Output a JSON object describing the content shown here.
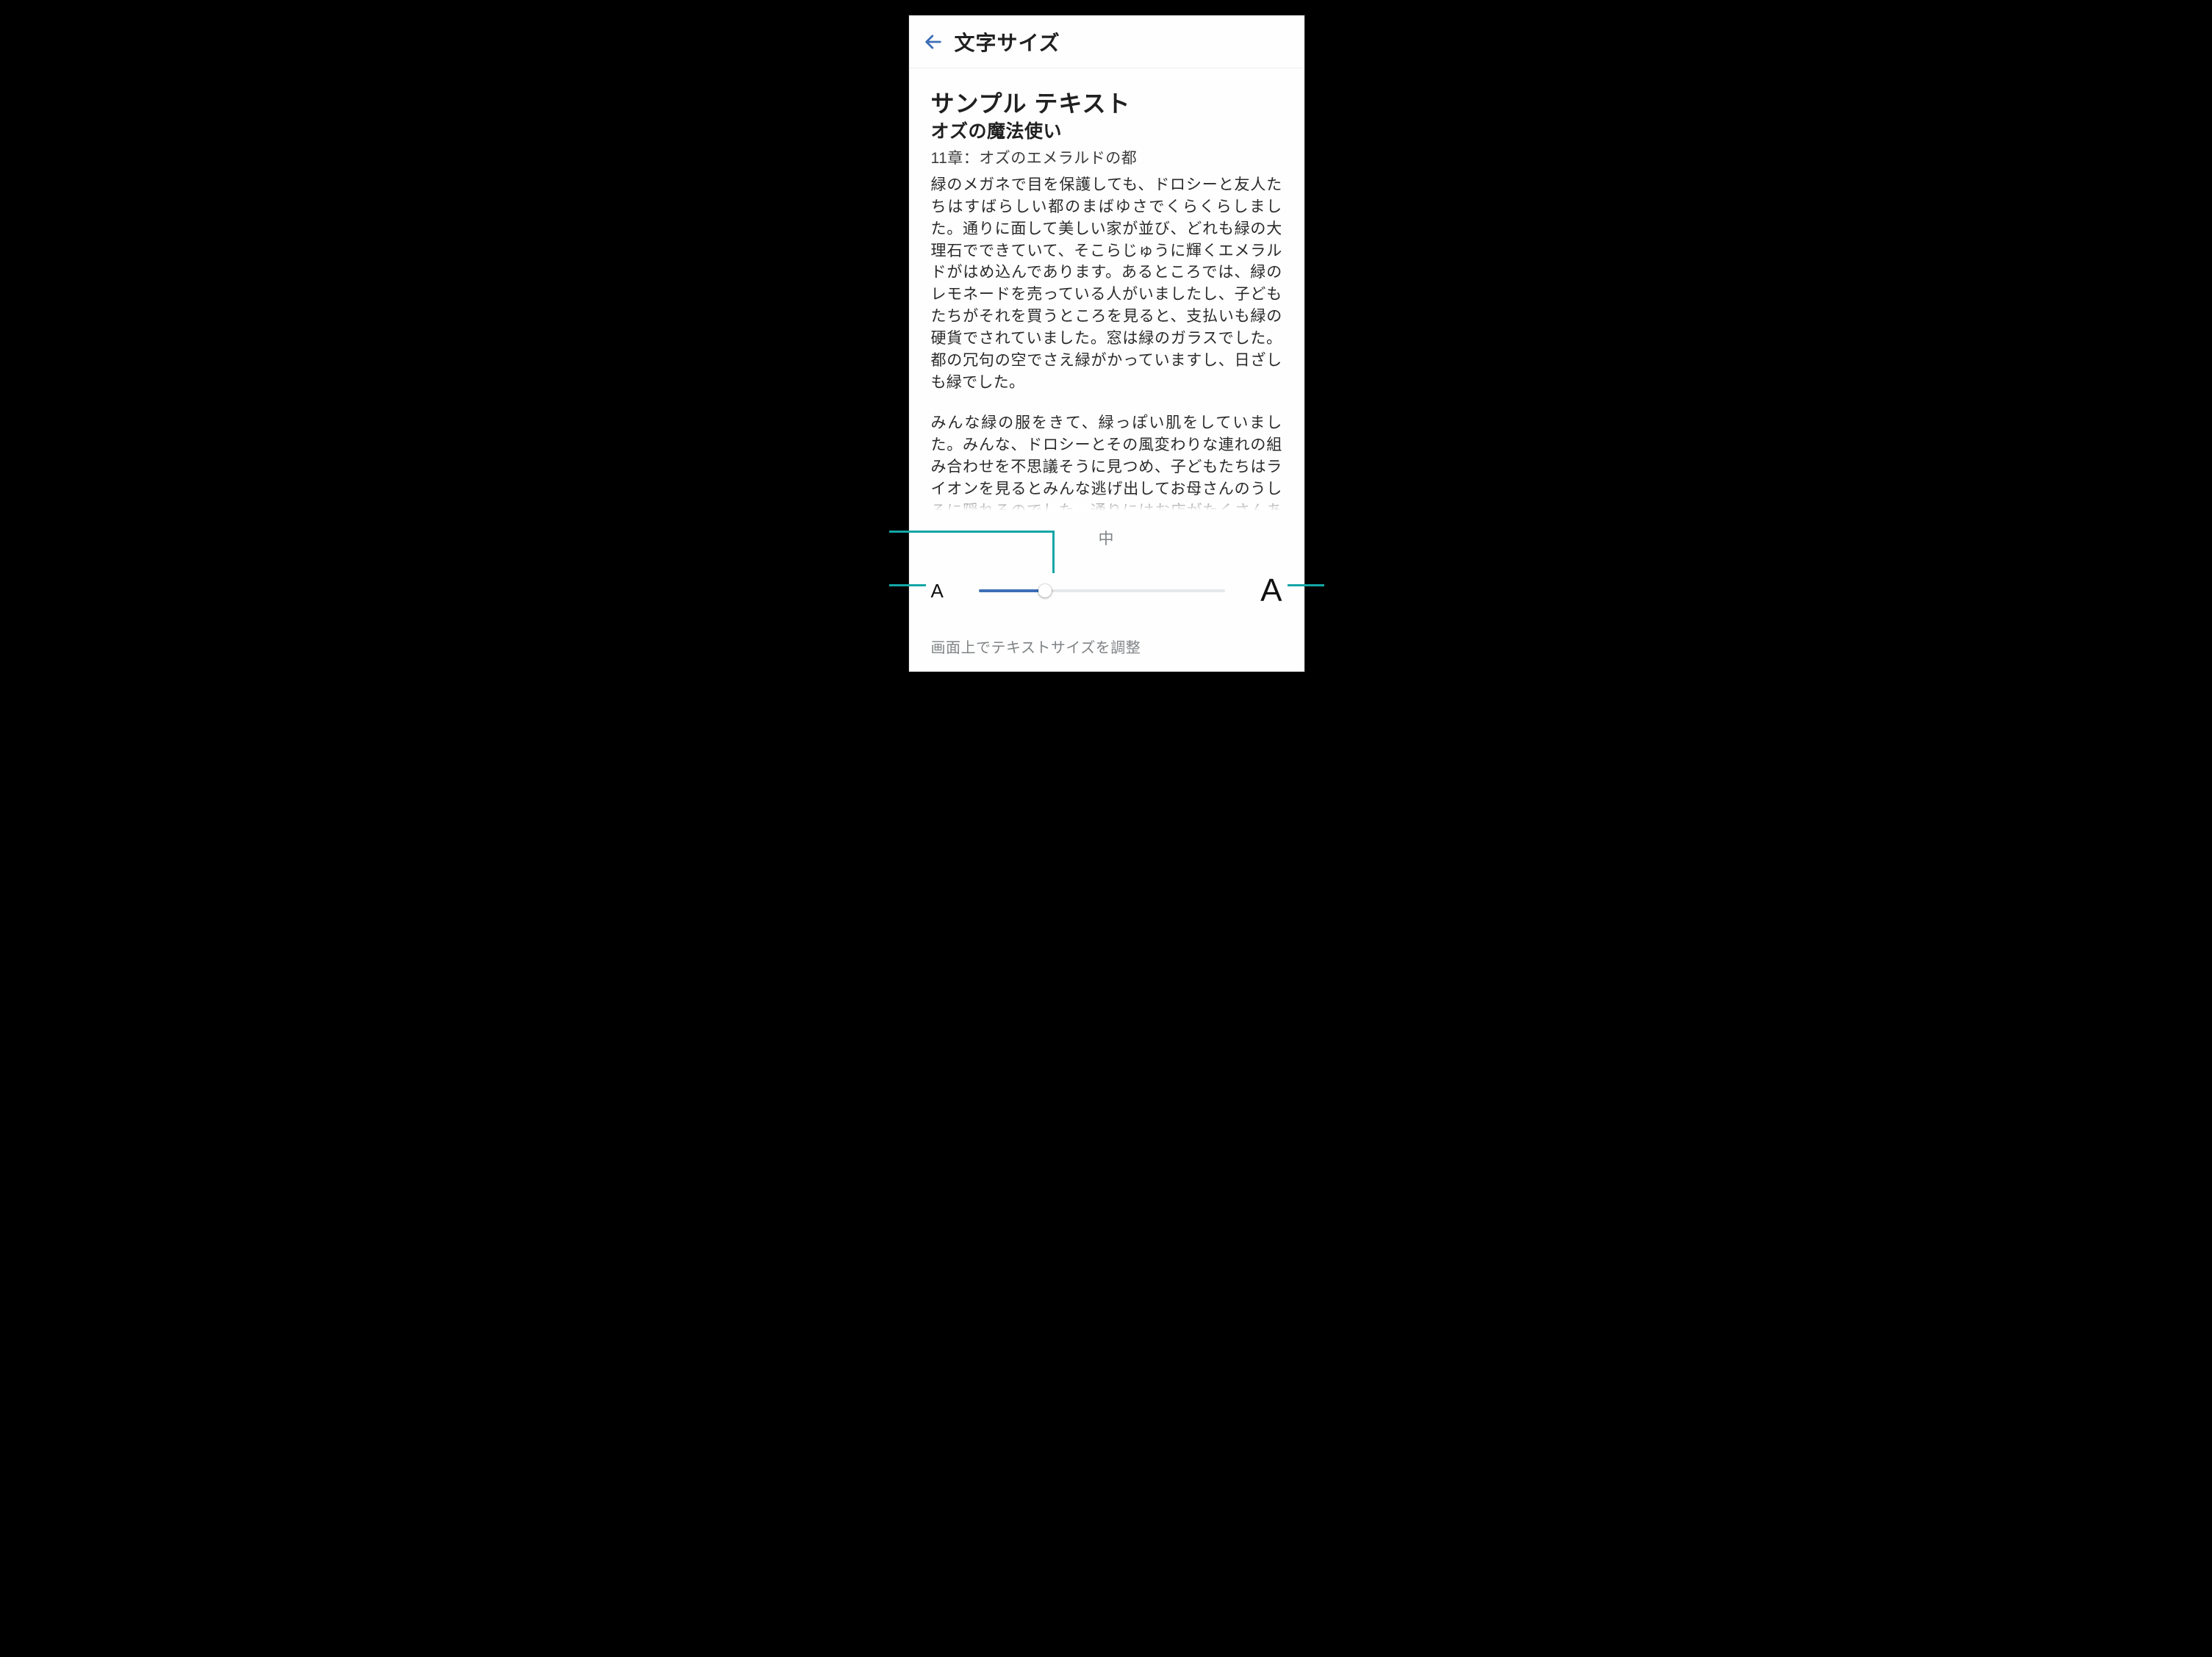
{
  "header": {
    "title": "文字サイズ"
  },
  "sample": {
    "heading": "サンプル テキスト",
    "book": "オズの魔法使い",
    "chapter": "11章：オズのエメラルドの都",
    "p1": "緑のメガネで目を保護しても、ドロシーと友人たちはすばらしい都のまばゆさでくらくらしました。通りに面して美しい家が並び、どれも緑の大理石でできていて、そこらじゅうに輝くエメラルドがはめ込んであります。あるところでは、緑のレモネードを売っている人がいましたし、子どもたちがそれを買うところを見ると、支払いも緑の硬貨でされていました。窓は緑のガラスでした。都の冗句の空でさえ緑がかっていますし、日ざしも緑でした。",
    "p2": "みんな緑の服をきて、緑っぽい肌をしていました。みんな、ドロシーとその風変わりな連れの組み合わせを不思議そうに見つめ、子どもたちはライオンを見るとみんな逃げ出してお母さんのうしろに隠れるのでした。通りにはお店がたくさんあって、並んでいるものはどれも緑色でした。緑の"
  },
  "slider": {
    "label": "中",
    "min_icon": "A",
    "max_icon": "A",
    "value_percent": 27,
    "min": 0,
    "max": 100
  },
  "hint": "画面上でテキストサイズを調整",
  "colors": {
    "accent": "#3e6fb6",
    "overlay": "#13a6a6",
    "muted": "#7f8385",
    "bg": "#000000"
  }
}
